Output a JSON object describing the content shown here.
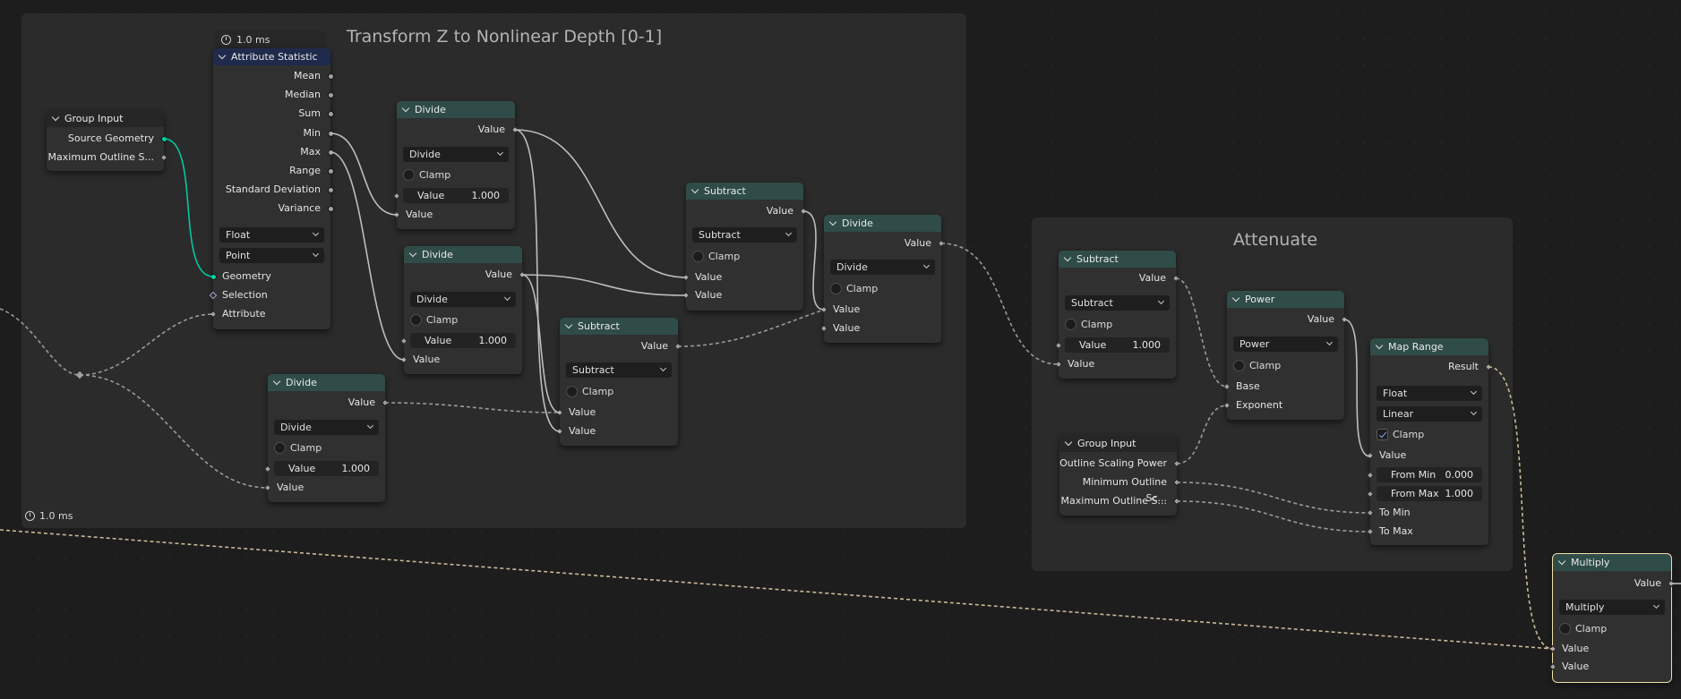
{
  "frames": {
    "transform": {
      "title": "Transform Z to Nonlinear Depth [0-1]",
      "timer": "1.0 ms"
    },
    "attenuate": {
      "title": "Attenuate"
    }
  },
  "attr_stat": {
    "timer": "1.0 ms",
    "title": "Attribute Statistic",
    "outputs": [
      "Mean",
      "Median",
      "Sum",
      "Min",
      "Max",
      "Range",
      "Standard Deviation",
      "Variance"
    ],
    "data_type": "Float",
    "domain": "Point",
    "inputs": [
      "Geometry",
      "Selection",
      "Attribute"
    ]
  },
  "group_input_1": {
    "title": "Group Input",
    "outputs": [
      "Source Geometry",
      "Maximum Outline S..."
    ]
  },
  "div1": {
    "title": "Divide",
    "out": "Value",
    "op": "Divide",
    "clamp": "Clamp",
    "val_label": "Value",
    "val": "1.000",
    "in": "Value"
  },
  "div2": {
    "title": "Divide",
    "out": "Value",
    "op": "Divide",
    "clamp": "Clamp",
    "val_label": "Value",
    "val": "1.000",
    "in": "Value"
  },
  "div3": {
    "title": "Divide",
    "out": "Value",
    "op": "Divide",
    "clamp": "Clamp",
    "val_label": "Value",
    "val": "1.000",
    "in": "Value"
  },
  "sub1": {
    "title": "Subtract",
    "out": "Value",
    "op": "Subtract",
    "clamp": "Clamp",
    "in1": "Value",
    "in2": "Value"
  },
  "sub2": {
    "title": "Subtract",
    "out": "Value",
    "op": "Subtract",
    "clamp": "Clamp",
    "in1": "Value",
    "in2": "Value"
  },
  "div4": {
    "title": "Divide",
    "out": "Value",
    "op": "Divide",
    "clamp": "Clamp",
    "in1": "Value",
    "in2": "Value"
  },
  "sub3": {
    "title": "Subtract",
    "out": "Value",
    "op": "Subtract",
    "clamp": "Clamp",
    "val_label": "Value",
    "val": "1.000",
    "in": "Value"
  },
  "power": {
    "title": "Power",
    "out": "Value",
    "op": "Power",
    "clamp": "Clamp",
    "in1": "Base",
    "in2": "Exponent"
  },
  "group_input_2": {
    "title": "Group Input",
    "outputs": [
      "Outline Scaling Power",
      "Minimum Outline Sc...",
      "Maximum Outline S..."
    ]
  },
  "map_range": {
    "title": "Map Range",
    "out": "Result",
    "data_type": "Float",
    "interp": "Linear",
    "clamp": "Clamp",
    "in_value": "Value",
    "from_min_label": "From Min",
    "from_min": "0.000",
    "from_max_label": "From Max",
    "from_max": "1.000",
    "to_min": "To Min",
    "to_max": "To Max"
  },
  "multiply": {
    "title": "Multiply",
    "out": "Value",
    "op": "Multiply",
    "clamp": "Clamp",
    "in1": "Value",
    "in2": "Value"
  }
}
